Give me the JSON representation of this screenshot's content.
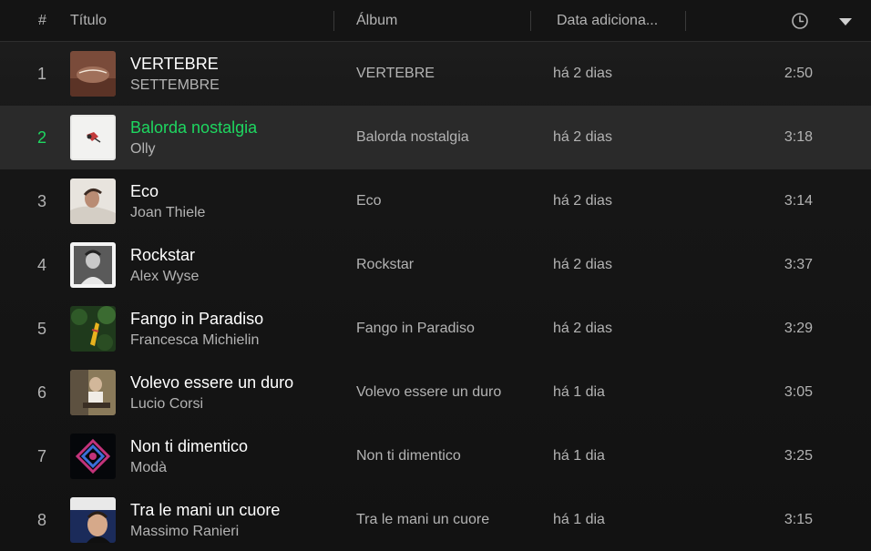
{
  "header": {
    "num": "#",
    "title": "Título",
    "album": "Álbum",
    "date_added": "Data adiciona...",
    "duration_icon": "clock-icon",
    "menu_icon": "caret-down-icon"
  },
  "colors": {
    "background": "#121212",
    "active_row": "#2a2a2a",
    "playing_green": "#1ed760",
    "primary_text": "#ffffff",
    "secondary_text": "#b3b3b3"
  },
  "tracks": [
    {
      "num": "1",
      "title": "VERTEBRE",
      "artist": "SETTEMBRE",
      "album": "VERTEBRE",
      "date_added": "há 2 dias",
      "duration": "2:50"
    },
    {
      "num": "2",
      "title": "Balorda nostalgia",
      "artist": "Olly",
      "album": "Balorda nostalgia",
      "date_added": "há 2 dias",
      "duration": "3:18",
      "playing": true
    },
    {
      "num": "3",
      "title": "Eco",
      "artist": "Joan Thiele",
      "album": "Eco",
      "date_added": "há 2 dias",
      "duration": "3:14"
    },
    {
      "num": "4",
      "title": "Rockstar",
      "artist": "Alex Wyse",
      "album": "Rockstar",
      "date_added": "há 2 dias",
      "duration": "3:37"
    },
    {
      "num": "5",
      "title": "Fango in Paradiso",
      "artist": "Francesca Michielin",
      "album": "Fango in Paradiso",
      "date_added": "há 2 dias",
      "duration": "3:29"
    },
    {
      "num": "6",
      "title": "Volevo essere un duro",
      "artist": "Lucio Corsi",
      "album": "Volevo essere un duro",
      "date_added": "há 1 dia",
      "duration": "3:05"
    },
    {
      "num": "7",
      "title": "Non ti dimentico",
      "artist": "Modà",
      "album": "Non ti dimentico",
      "date_added": "há 1 dia",
      "duration": "3:25"
    },
    {
      "num": "8",
      "title": "Tra le mani un cuore",
      "artist": "Massimo Ranieri",
      "album": "Tra le mani un cuore",
      "date_added": "há 1 dia",
      "duration": "3:15"
    }
  ]
}
